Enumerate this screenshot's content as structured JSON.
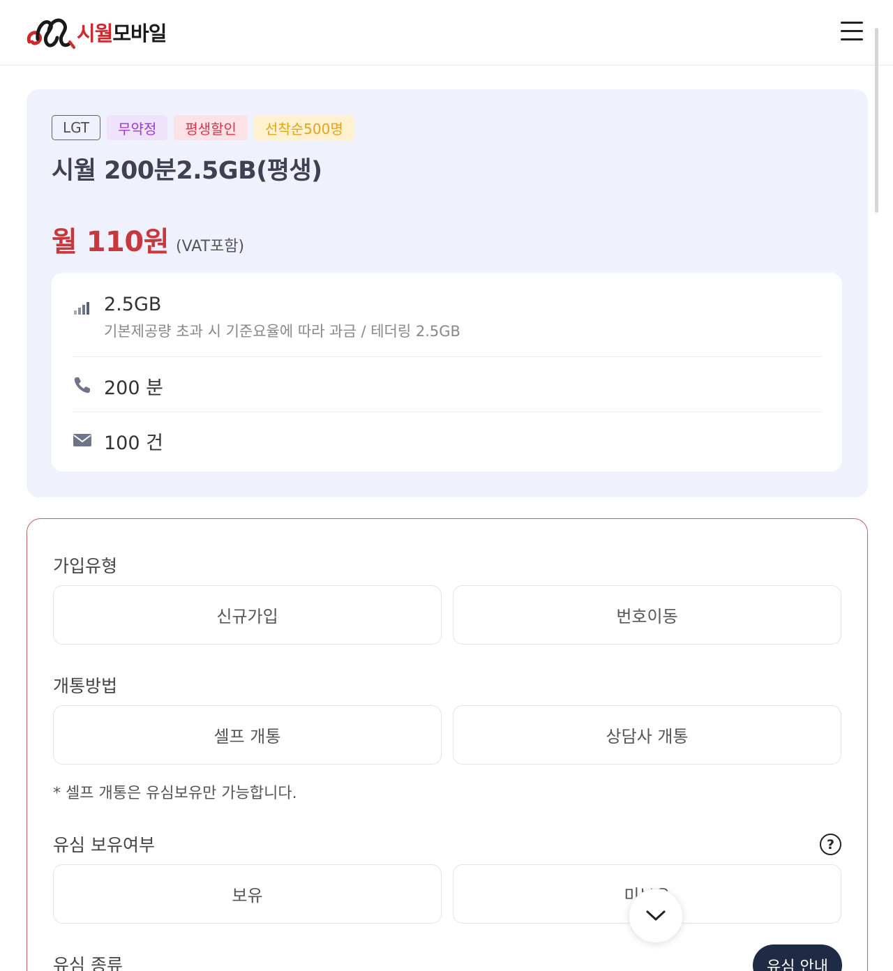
{
  "header": {
    "logo_text_red": "시월",
    "logo_text_dark": "모바일",
    "menu_icon": "hamburger-icon"
  },
  "plan": {
    "tags": {
      "carrier": "LGT",
      "no_contract": "무약정",
      "lifetime_discount": "평생할인",
      "first_come": "선착순500명"
    },
    "title": "시월 200분2.5GB(평생)",
    "price": "월 110원",
    "vat_note": "(VAT포함)",
    "specs": {
      "data_main": "2.5GB",
      "data_sub": "기본제공량 초과 시 기준요율에 따라 과금 / 테더링 2.5GB",
      "voice": "200 분",
      "sms": "100 건"
    }
  },
  "form": {
    "join_type": {
      "label": "가입유형",
      "options": [
        "신규가입",
        "번호이동"
      ]
    },
    "activation": {
      "label": "개통방법",
      "options": [
        "셀프 개통",
        "상담사 개통"
      ],
      "note": "* 셀프 개통은 유심보유만 가능합니다."
    },
    "sim_owned": {
      "label": "유심 보유여부",
      "help": "?",
      "options": [
        "보유",
        "미보유"
      ]
    },
    "sim_type": {
      "label": "유심 종류",
      "guide_button": "유심 안내"
    }
  },
  "colors": {
    "brand_red": "#c8373c",
    "card_bg": "#eff1fd",
    "form_border": "#c0625f",
    "guide_button_bg": "#1f2a44"
  }
}
